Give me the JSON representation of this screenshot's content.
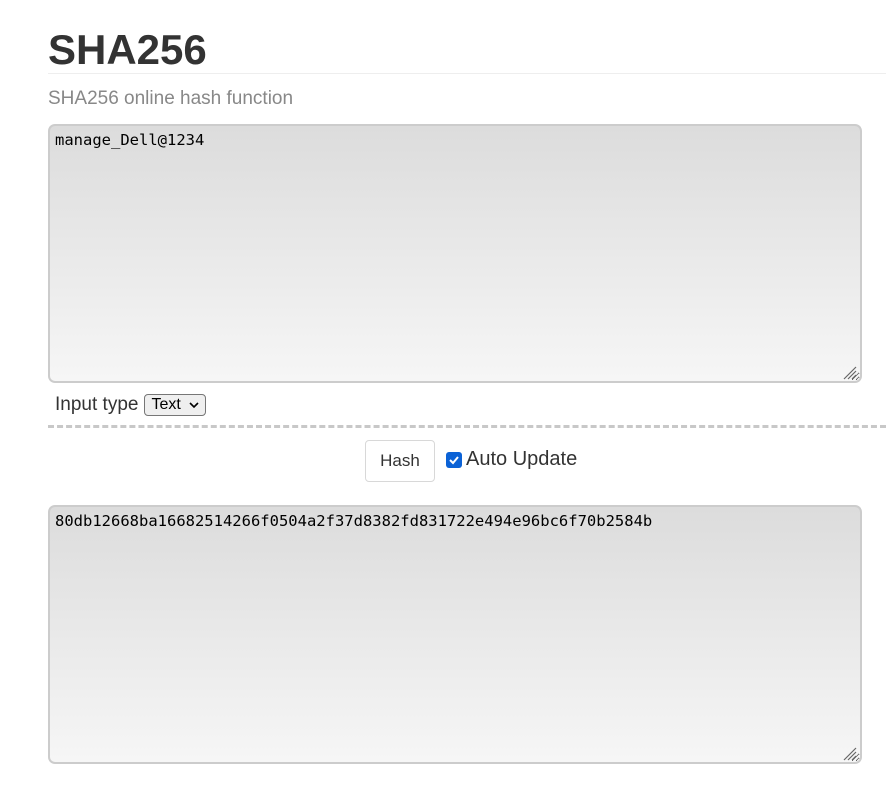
{
  "header": {
    "title": "SHA256",
    "subtitle": "SHA256 online hash function"
  },
  "input": {
    "value": "manage_Dell@1234"
  },
  "input_type": {
    "label": "Input type",
    "selected": "Text"
  },
  "controls": {
    "hash_label": "Hash",
    "auto_update_label": "Auto Update",
    "auto_update_checked": true
  },
  "output": {
    "value": "80db12668ba16682514266f0504a2f37d8382fd831722e494e96bc6f70b2584b"
  }
}
